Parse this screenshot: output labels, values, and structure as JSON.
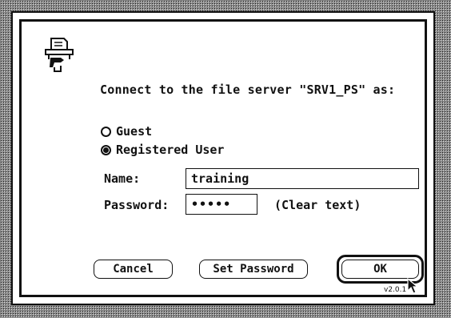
{
  "prompt": "Connect to the file server \"SRV1_PS\" as:",
  "login_options": {
    "guest_label": "Guest",
    "registered_label": "Registered User",
    "selected": "Registered User"
  },
  "name": {
    "label": "Name:",
    "value": "training"
  },
  "password": {
    "label": "Password:",
    "value": "•••••",
    "mode_label": "(Clear text)"
  },
  "buttons": {
    "cancel": "Cancel",
    "set_password": "Set Password",
    "ok": "OK",
    "default": "OK"
  },
  "version": "v2.0.1",
  "icons": [
    "file-server-icon",
    "radio-unselected-icon",
    "radio-selected-icon",
    "arrow-cursor-icon"
  ]
}
